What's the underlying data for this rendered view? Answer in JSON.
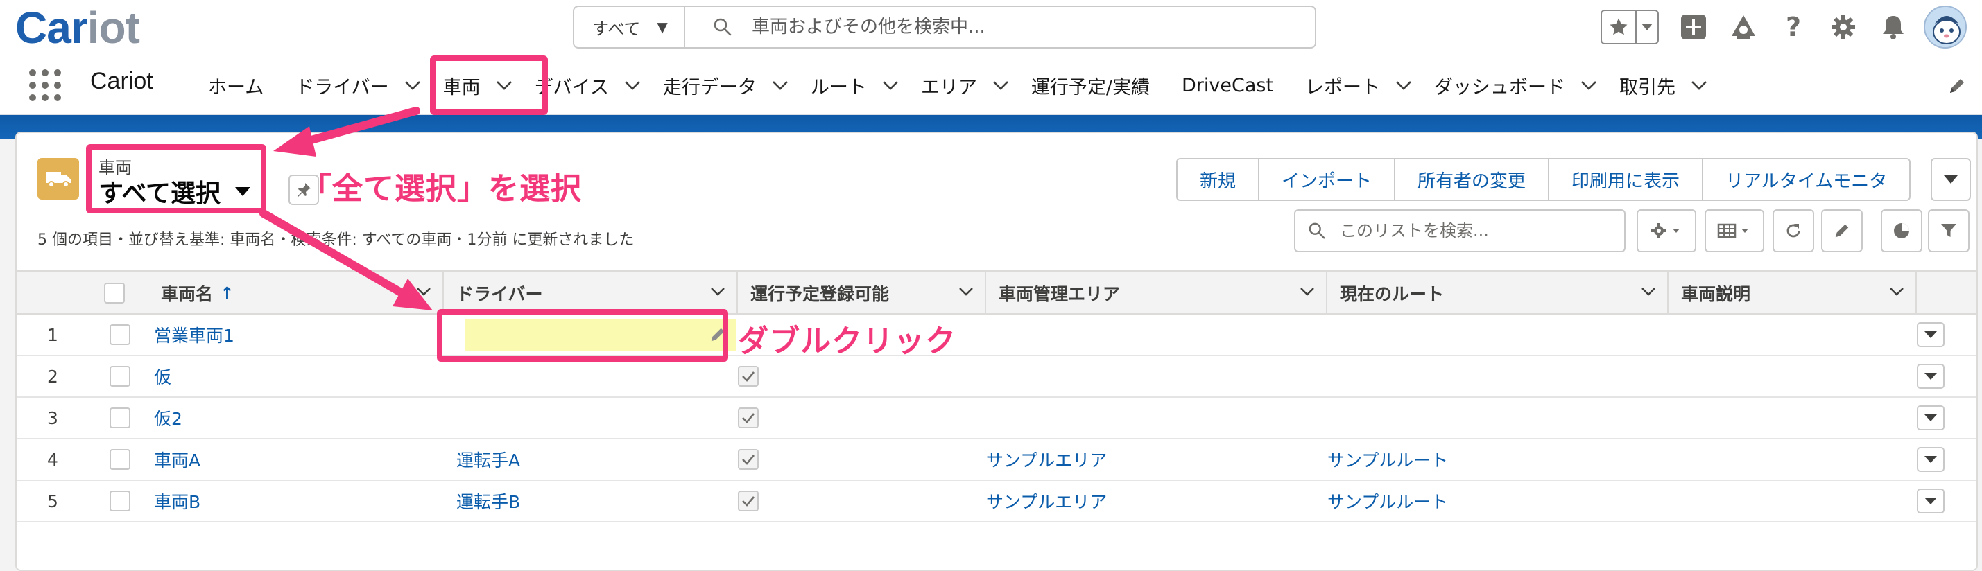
{
  "brand": {
    "logo_part1": "Car",
    "logo_part2": "iot"
  },
  "global_search": {
    "scope": "すべて",
    "placeholder": "車両およびその他を検索中..."
  },
  "nav": {
    "app_name": "Cariot",
    "tabs": [
      {
        "label": "ホーム",
        "chevron": false
      },
      {
        "label": "ドライバー",
        "chevron": true
      },
      {
        "label": "車両",
        "chevron": true,
        "active": true
      },
      {
        "label": "デバイス",
        "chevron": true
      },
      {
        "label": "走行データ",
        "chevron": true
      },
      {
        "label": "ルート",
        "chevron": true
      },
      {
        "label": "エリア",
        "chevron": true
      },
      {
        "label": "運行予定/実績",
        "chevron": false
      },
      {
        "label": "DriveCast",
        "chevron": false
      },
      {
        "label": "レポート",
        "chevron": true
      },
      {
        "label": "ダッシュボード",
        "chevron": true
      },
      {
        "label": "取引先",
        "chevron": true
      }
    ]
  },
  "list_view": {
    "object_label": "車両",
    "view_name": "すべて選択",
    "status": "5 個の項目・並び替え基準: 車両名・検索条件: すべての車両・1分前 に更新されました",
    "actions": [
      "新規",
      "インポート",
      "所有者の変更",
      "印刷用に表示",
      "リアルタイムモニタ"
    ],
    "search_placeholder": "このリストを検索..."
  },
  "table": {
    "columns": [
      "車両名",
      "ドライバー",
      "運行予定登録可能",
      "車両管理エリア",
      "現在のルート",
      "車両説明"
    ],
    "sort_indicator": "↑",
    "rows": [
      {
        "num": "1",
        "name": "営業車両1",
        "driver": "",
        "bookable": false,
        "area": "",
        "route": ""
      },
      {
        "num": "2",
        "name": "仮",
        "driver": "",
        "bookable": true,
        "area": "",
        "route": ""
      },
      {
        "num": "3",
        "name": "仮2",
        "driver": "",
        "bookable": true,
        "area": "",
        "route": ""
      },
      {
        "num": "4",
        "name": "車両A",
        "driver": "運転手A",
        "bookable": true,
        "area": "サンプルエリア",
        "route": "サンプルルート"
      },
      {
        "num": "5",
        "name": "車両B",
        "driver": "運転手B",
        "bookable": true,
        "area": "サンプルエリア",
        "route": "サンプルルート"
      }
    ]
  },
  "annotations": {
    "select_all_note": "「全て選択」を選択",
    "double_click_note": "ダブルクリック",
    "color": "#f2387a"
  },
  "colors": {
    "link": "#0b5cab",
    "nav_band": "#1466b8",
    "object_icon": "#e3b255",
    "edit_highlight": "#fafab0"
  }
}
